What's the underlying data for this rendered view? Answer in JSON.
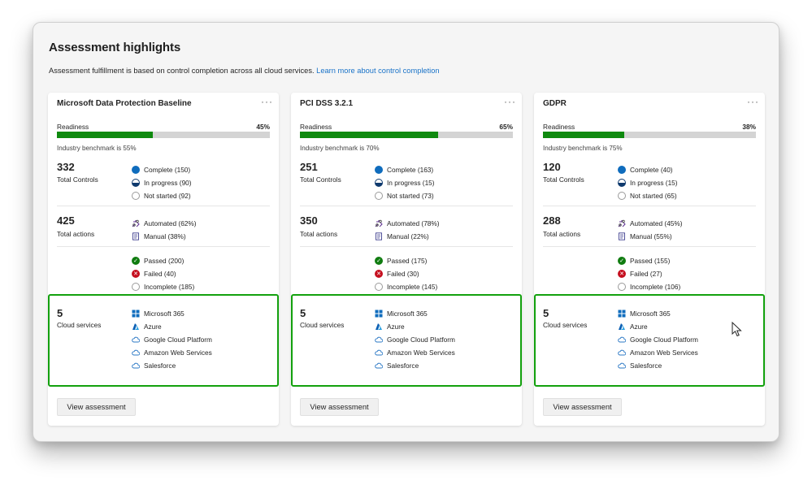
{
  "header": {
    "title": "Assessment highlights",
    "description": "Assessment fulfillment is based on control completion across all cloud services.",
    "link_text": "Learn more about control completion"
  },
  "labels": {
    "readiness": "Readiness",
    "total_controls": "Total Controls",
    "total_actions": "Total actions",
    "cloud_services": "Cloud services",
    "view_button": "View assessment",
    "more": "···"
  },
  "cards": [
    {
      "name": "Microsoft Data Protection Baseline",
      "readiness_pct": "45%",
      "readiness_value": 45,
      "benchmark": "Industry benchmark is 55%",
      "total_controls": "332",
      "complete": "Complete (150)",
      "in_progress": "In progress (90)",
      "not_started": "Not started (92)",
      "total_actions": "425",
      "automated": "Automated (62%)",
      "manual": "Manual (38%)",
      "passed": "Passed (200)",
      "failed": "Failed (40)",
      "incomplete": "Incomplete (185)",
      "cloud_count": "5",
      "services": [
        "Microsoft 365",
        "Azure",
        "Google Cloud Platform",
        "Amazon Web Services",
        "Salesforce"
      ]
    },
    {
      "name": "PCI DSS 3.2.1",
      "readiness_pct": "65%",
      "readiness_value": 65,
      "benchmark": "Industry benchmark is 70%",
      "total_controls": "251",
      "complete": "Complete (163)",
      "in_progress": "In progress (15)",
      "not_started": "Not started (73)",
      "total_actions": "350",
      "automated": "Automated (78%)",
      "manual": "Manual (22%)",
      "passed": "Passed (175)",
      "failed": "Failed (30)",
      "incomplete": "Incomplete (145)",
      "cloud_count": "5",
      "services": [
        "Microsoft 365",
        "Azure",
        "Google Cloud Platform",
        "Amazon Web Services",
        "Salesforce"
      ]
    },
    {
      "name": "GDPR",
      "readiness_pct": "38%",
      "readiness_value": 38,
      "benchmark": "Industry benchmark is 75%",
      "total_controls": "120",
      "complete": "Complete (40)",
      "in_progress": "In progress (15)",
      "not_started": "Not started (65)",
      "total_actions": "288",
      "automated": "Automated (45%)",
      "manual": "Manual (55%)",
      "passed": "Passed (155)",
      "failed": "Failed (27)",
      "incomplete": "Incomplete (106)",
      "cloud_count": "5",
      "services": [
        "Microsoft 365",
        "Azure",
        "Google Cloud Platform",
        "Amazon Web Services",
        "Salesforce"
      ]
    }
  ],
  "colors": {
    "progress_fill": "#0f8a0f",
    "highlight_border": "#13a10e",
    "link": "#1a73c8"
  },
  "icons": {
    "services": [
      "windows-logo-icon",
      "azure-logo-icon",
      "cloud-icon",
      "cloud-icon",
      "cloud-icon"
    ]
  }
}
